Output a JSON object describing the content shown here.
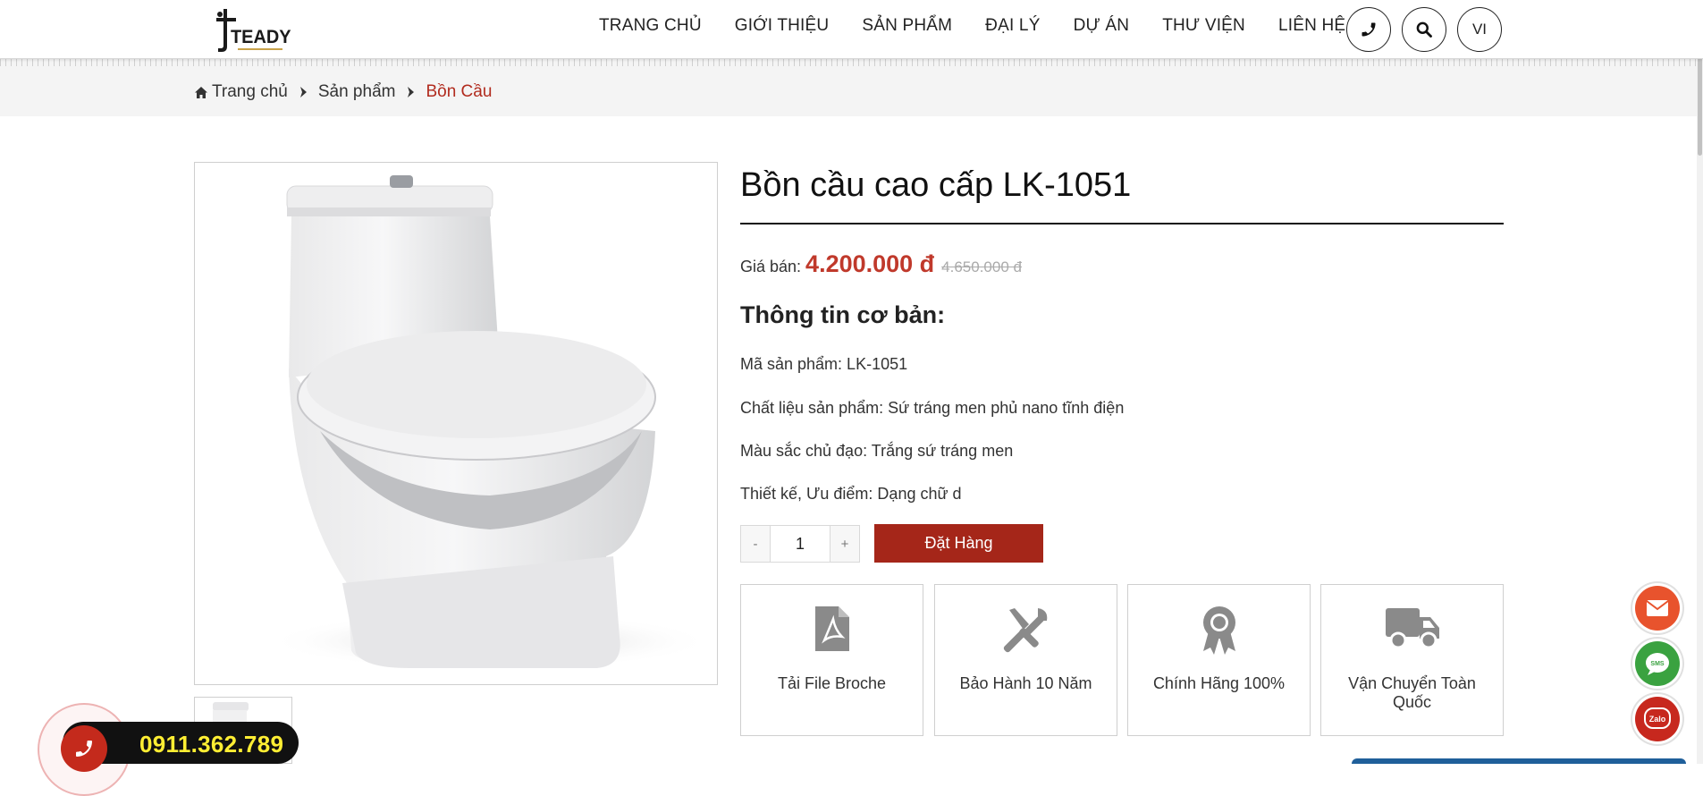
{
  "brand": {
    "name": "TEADY"
  },
  "nav": {
    "items": [
      {
        "label": "TRANG CHỦ"
      },
      {
        "label": "GIỚI THIỆU"
      },
      {
        "label": "SẢN PHẨM"
      },
      {
        "label": "ĐẠI LÝ"
      },
      {
        "label": "DỰ ÁN"
      },
      {
        "label": "THƯ VIỆN"
      },
      {
        "label": "LIÊN HỆ"
      }
    ],
    "phone_icon": "phone-icon",
    "search_icon": "search-icon",
    "language": "VI"
  },
  "breadcrumb": {
    "items": [
      "Trang chủ",
      "Sản phẩm",
      "Bồn Cầu"
    ]
  },
  "product": {
    "title": "Bồn cầu cao cấp LK-1051",
    "price_label": "Giá bán:",
    "price_now": "4.200.000 đ",
    "price_old": "4.650.000 đ",
    "basic_info_title": "Thông tin cơ bản:",
    "specs": [
      "Mã sản phẩm: LK-1051",
      "Chất liệu sản phẩm: Sứ tráng men phủ nano tĩnh điện",
      "Màu sắc chủ đạo: Trắng sứ tráng men",
      "Thiết kế, Ưu điểm: Dạng chữ d"
    ],
    "quantity": {
      "minus": "-",
      "value": "1",
      "plus": "+"
    },
    "order_button": "Đặt Hàng"
  },
  "features": [
    {
      "label": "Tải File Broche",
      "icon": "pdf-file-icon"
    },
    {
      "label": "Bảo Hành 10 Năm",
      "icon": "tools-icon"
    },
    {
      "label": "Chính Hãng 100%",
      "icon": "award-icon"
    },
    {
      "label": "Vận Chuyển Toàn Quốc",
      "icon": "truck-icon"
    }
  ],
  "floating": {
    "zalo_label": "Zalo",
    "sms_label": "SMS"
  },
  "hotline": {
    "number": "0911.362.789"
  },
  "colors": {
    "accent": "#a52619",
    "price": "#c0392b",
    "hotline_text": "#ffee33"
  }
}
